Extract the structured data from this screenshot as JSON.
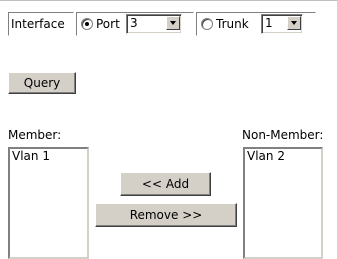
{
  "interface": {
    "label": "Interface",
    "port_label": "Port",
    "port_value": "3",
    "trunk_label": "Trunk",
    "trunk_value": "1",
    "selected": "Port"
  },
  "query": {
    "button_label": "Query"
  },
  "member": {
    "label": "Member:",
    "items": [
      "Vlan 1"
    ]
  },
  "non_member": {
    "label": "Non-Member:",
    "items": [
      "Vlan 2"
    ]
  },
  "actions": {
    "add_label": "<< Add",
    "remove_label": "Remove >>"
  },
  "colors": {
    "face": "#d4d0c8",
    "shadow": "#808080",
    "dark": "#404040"
  }
}
